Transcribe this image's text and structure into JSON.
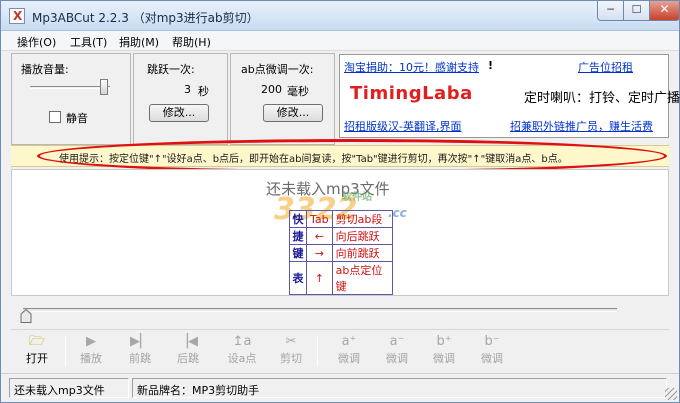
{
  "window": {
    "title": "Mp3ABCut 2.2.3 （对mp3进行ab剪切）",
    "minimize_glyph": "─",
    "maximize_glyph": "☐",
    "close_glyph": "✕"
  },
  "menu": [
    "操作(O)",
    "工具(T)",
    "捐助(M)",
    "帮助(H)"
  ],
  "volume": {
    "label": "播放音量:",
    "mute_label": "静音",
    "mute_checked": false
  },
  "jump": {
    "label": "跳跃一次:",
    "value": "3",
    "unit": "秒",
    "button": "修改..."
  },
  "ab_adjust": {
    "label": "ab点微调一次:",
    "value": "200",
    "unit": "毫秒",
    "button": "修改..."
  },
  "ad": {
    "donate_link": "淘宝捐助：10元！感谢支持",
    "donate_exclaim": "!",
    "ad_link": "广告位招租",
    "logo": "TimingLaba",
    "slogan": "定时喇叭：打铃、定时广播",
    "recruit_link": "招租版级汉-英翻译,界面",
    "promo_link": "招兼职外链推广员，赚生活费"
  },
  "hint": "使用提示：按定位键\"↑\"设好a点、b点后，即开始在ab间复读，按\"Tab\"键进行剪切，再次按\"↑\"键取消a点、b点。",
  "display": {
    "no_file": "还未载入mp3文件",
    "watermark_number": "3322",
    "watermark_suffix": ".cc",
    "watermark_sub": "软件站",
    "shortcut_table": {
      "title_chars": [
        "快",
        "捷",
        "键",
        "表"
      ],
      "rows": [
        {
          "key": "Tab",
          "desc": "剪切ab段"
        },
        {
          "key": "←",
          "desc": "向后跳跃"
        },
        {
          "key": "→",
          "desc": "向前跳跃"
        },
        {
          "key": "↑",
          "desc": "ab点定位键"
        }
      ]
    }
  },
  "toolbar": [
    {
      "icon": "open-folder-icon",
      "glyph": "🗁",
      "label": "打开",
      "enabled": true
    },
    {
      "icon": "play-icon",
      "glyph": "▶",
      "label": "播放",
      "enabled": false
    },
    {
      "icon": "forward-jump-icon",
      "glyph": "▶▏",
      "label": "前跳",
      "enabled": false
    },
    {
      "icon": "back-jump-icon",
      "glyph": "▕◀",
      "label": "后跳",
      "enabled": false
    },
    {
      "icon": "set-a-point-icon",
      "glyph": "↥a",
      "label": "设a点",
      "enabled": false
    },
    {
      "icon": "cut-icon",
      "glyph": "✂",
      "label": "剪切",
      "enabled": false
    },
    {
      "icon": "a-plus-icon",
      "glyph": "a⁺",
      "label": "微调",
      "enabled": false
    },
    {
      "icon": "a-minus-icon",
      "glyph": "a⁻",
      "label": "微调",
      "enabled": false
    },
    {
      "icon": "b-plus-icon",
      "glyph": "b⁺",
      "label": "微调",
      "enabled": false
    },
    {
      "icon": "b-minus-icon",
      "glyph": "b⁻",
      "label": "微调",
      "enabled": false
    }
  ],
  "status": {
    "file_status": "还未载入mp3文件",
    "brand": "新品牌名：MP3剪切助手"
  }
}
